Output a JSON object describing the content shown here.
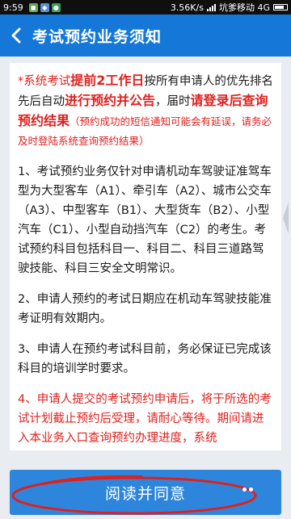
{
  "status_bar": {
    "time": "9:59",
    "network_speed": "3.56K/s",
    "carrier": "坑爹移动 4G",
    "left_icons": [
      "app-notification-icon",
      "app-notification-icon",
      "app-notification-icon"
    ],
    "right_icons": [
      "signal-icon",
      "battery-icon"
    ]
  },
  "header": {
    "title": "考试预约业务须知",
    "background": "#1578d8",
    "back_icon": "chevron-left-icon"
  },
  "notice": {
    "p1_a": "*系统考试",
    "p1_b": "提前2工作日",
    "p1_c": "按所有申请人的优先排名先后自动",
    "p1_d": "进行预约并公告",
    "p1_e": "，届时",
    "p1_f": "请登录后查询预约结果",
    "p1_g": "（预约成功的短信通知可能会有延误，请务必及时登陆系统查询预约结果）",
    "p2": "1、考试预约业务仅针对申请机动车驾驶证准驾车型为大型客车（A1）、牵引车（A2）、城市公交车（A3）、中型客车（B1）、大型货车（B2）、小型汽车（C1）、小型自动挡汽车（C2）的考生。考试预约科目包括科目一、科目二、科目三道路驾驶技能、科目三安全文明常识。",
    "p3": "2、申请人预约的考试日期应在机动车驾驶技能准考证明有效期内。",
    "p4": "3、申请人在预约考试科目前，务必保证已完成该科目的培训学时要求。",
    "p5": "4、申请人提交的考试预约申请后，将于所选的考试计划截止预约后受理，请耐心等待。期间请进入本业务入口查询预约办理进度，系统"
  },
  "footer": {
    "agree_label": "阅读并同意",
    "button_color": "#2e86dc",
    "highlight_color": "#e0201e"
  }
}
